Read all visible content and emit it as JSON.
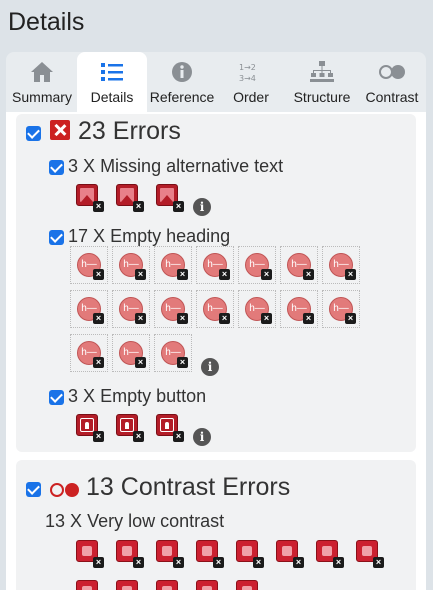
{
  "page": {
    "title": "Details"
  },
  "tabs": [
    {
      "label": "Summary",
      "icon": "home-icon",
      "active": false
    },
    {
      "label": "Details",
      "icon": "list-icon",
      "active": true
    },
    {
      "label": "Reference",
      "icon": "info-circle-icon",
      "active": false
    },
    {
      "label": "Order",
      "icon": "order-icon",
      "active": false
    },
    {
      "label": "Structure",
      "icon": "structure-icon",
      "active": false
    },
    {
      "label": "Contrast",
      "icon": "contrast-icon",
      "active": false
    }
  ],
  "errors": {
    "checked": true,
    "count": "23",
    "label": "Errors",
    "icon": "error-x-icon",
    "color": "#cc2222",
    "groups": [
      {
        "checked": true,
        "count": "3",
        "label": "Missing alternative text",
        "icon": "missing-alt-icon",
        "items": 3
      },
      {
        "checked": true,
        "count": "17",
        "label": "Empty heading",
        "icon": "empty-heading-icon",
        "items": 17
      },
      {
        "checked": true,
        "count": "3",
        "label": "Empty button",
        "icon": "empty-button-icon",
        "items": 3
      }
    ]
  },
  "contrast": {
    "checked": true,
    "count": "13",
    "label": "Contrast Errors",
    "icon": "contrast-errors-icon",
    "groups": [
      {
        "count": "13",
        "label": "Very low contrast",
        "icon": "very-low-contrast-icon",
        "items": 13
      }
    ]
  },
  "ui": {
    "x_sep": "X",
    "heading_glyph": "h—",
    "badge_glyph": "×",
    "info_glyph": "i"
  }
}
